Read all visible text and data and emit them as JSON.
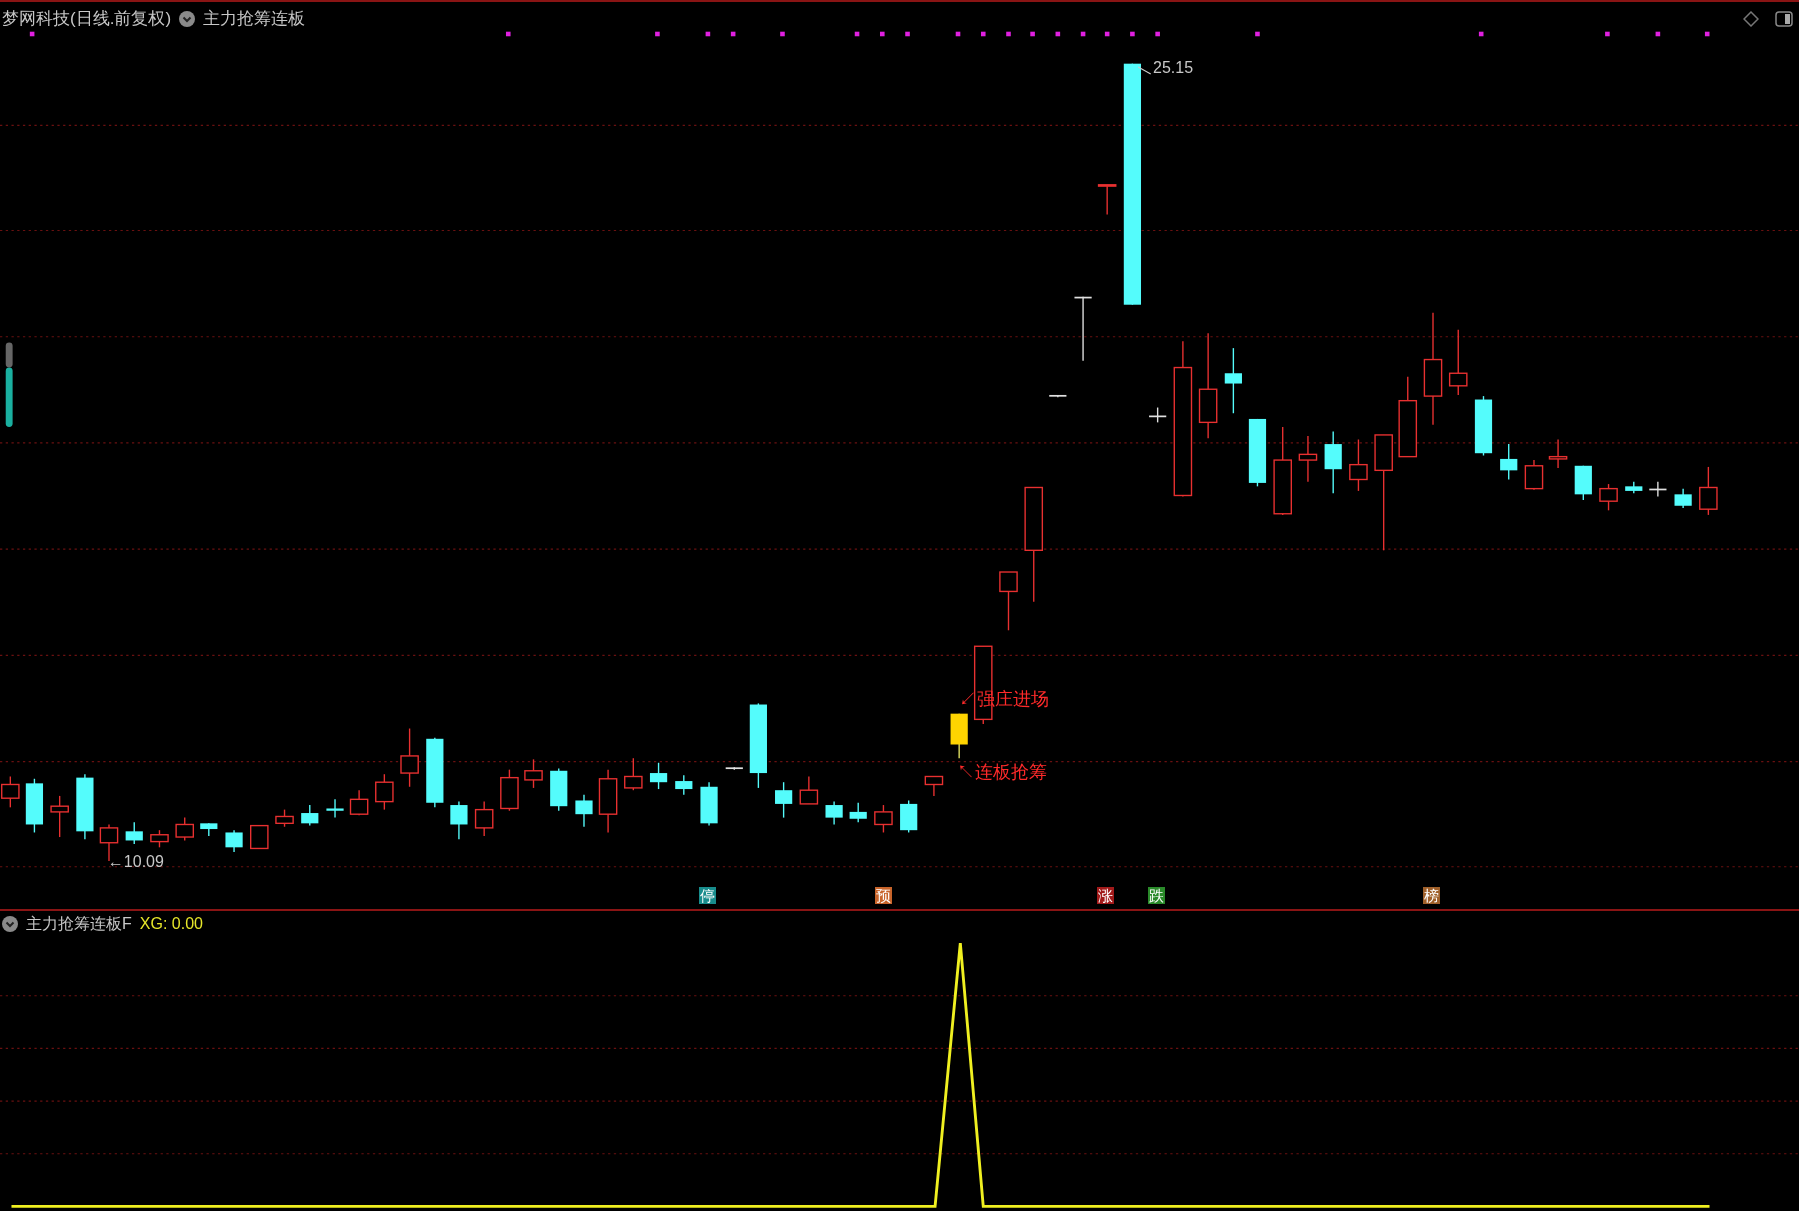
{
  "header": {
    "stock_title": "梦网科技(日线.前复权)",
    "indicator_name": "主力抢筹连板"
  },
  "price_labels": [
    {
      "kind": "high",
      "text": "25.15"
    },
    {
      "kind": "low",
      "text": "←10.09"
    }
  ],
  "annotations": [
    {
      "kind": "above",
      "text": "↙强庄进场"
    },
    {
      "kind": "below",
      "text": "↖连板抢筹"
    }
  ],
  "event_badges": [
    {
      "text": "停",
      "color": "#188c8c"
    },
    {
      "text": "预",
      "color": "#c8642a"
    },
    {
      "text": "涨",
      "color": "#a21a1a"
    },
    {
      "text": "跌",
      "color": "#2a8a2a"
    },
    {
      "text": "榜",
      "color": "#a0602a"
    }
  ],
  "lower_panel": {
    "indicator_name": "主力抢筹连板F",
    "reading": "XG: 0.00"
  }
}
